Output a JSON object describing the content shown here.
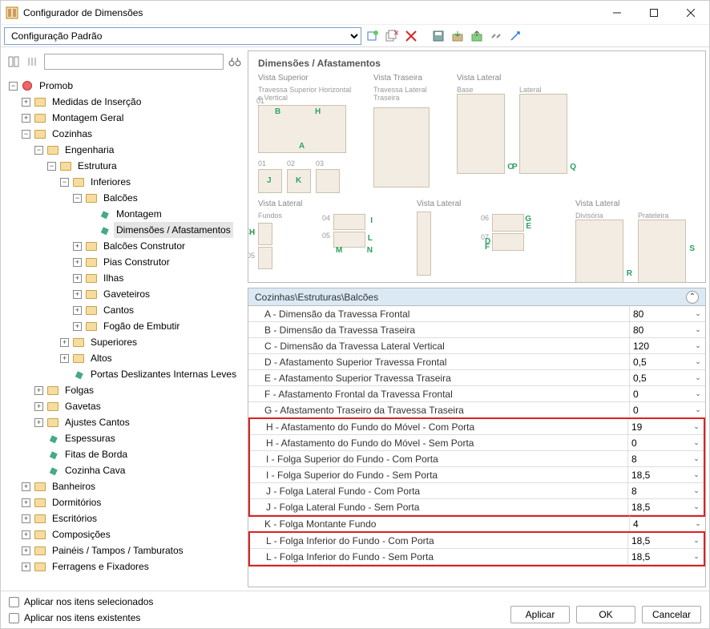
{
  "window": {
    "title": "Configurador de Dimensões"
  },
  "toolbar": {
    "config_selected": "Configuração Padrão"
  },
  "filter": {
    "placeholder": ""
  },
  "tree": {
    "root": "Promob",
    "n1": "Medidas de Inserção",
    "n2": "Montagem Geral",
    "n3": "Cozinhas",
    "n3_1": "Engenharia",
    "n3_1_1": "Estrutura",
    "n3_1_1_1": "Inferiores",
    "n3_1_1_1_1": "Balcões",
    "n3_1_1_1_1_1": "Montagem",
    "n3_1_1_1_1_2": "Dimensões / Afastamentos",
    "n3_1_1_1_2": "Balcões Construtor",
    "n3_1_1_1_3": "Pias Construtor",
    "n3_1_1_1_4": "Ilhas",
    "n3_1_1_1_5": "Gaveteiros",
    "n3_1_1_1_6": "Cantos",
    "n3_1_1_1_7": "Fogão de Embutir",
    "n3_1_1_2": "Superiores",
    "n3_1_1_3": "Altos",
    "n3_1_1_4": "Portas Deslizantes Internas Leves",
    "n3_2": "Folgas",
    "n3_3": "Gavetas",
    "n3_4": "Ajustes Cantos",
    "n3_5": "Espessuras",
    "n3_6": "Fitas de Borda",
    "n3_7": "Cozinha Cava",
    "n4": "Banheiros",
    "n5": "Dormitórios",
    "n6": "Escritórios",
    "n7": "Composições",
    "n8": "Painéis / Tampos / Tamburatos",
    "n9": "Ferragens e Fixadores"
  },
  "diagram": {
    "title": "Dimensões / Afastamentos",
    "v1": "Vista Superior",
    "v1s": "Travessa Superior Horizontal e Vertical",
    "v2": "Vista Traseira",
    "v2s": "Travessa Lateral Traseira",
    "v3": "Vista Lateral",
    "v3s": "Base",
    "v3s2": "Lateral",
    "v4": "Vista Lateral",
    "v4s": "Fundos",
    "v5": "Vista Lateral",
    "v6": "Vista Lateral",
    "v6s": "Divisória",
    "v6s2": "Prateleira",
    "dims": {
      "A": "A",
      "B": "B",
      "H": "H",
      "J": "J",
      "K": "K",
      "I": "I",
      "L": "L",
      "M": "M",
      "N": "N",
      "O": "O",
      "P": "P",
      "Q": "Q",
      "R": "R",
      "S": "S",
      "G": "G",
      "D": "D",
      "F": "F",
      "E": "E"
    },
    "nums": {
      "o1": "01",
      "o2": "02",
      "o3": "03",
      "o4": "04",
      "o5": "05",
      "o6": "06",
      "o7": "07"
    }
  },
  "props": {
    "header": "Cozinhas\\Estruturas\\Balcões",
    "rows": [
      {
        "label": "A - Dimensão da Travessa Frontal",
        "value": "80",
        "hl": false
      },
      {
        "label": "B - Dimensão da Travessa Traseira",
        "value": "80",
        "hl": false
      },
      {
        "label": "C - Dimensão da Travessa Lateral Vertical",
        "value": "120",
        "hl": false
      },
      {
        "label": "D - Afastamento Superior Travessa Frontal",
        "value": "0,5",
        "hl": false
      },
      {
        "label": "E - Afastamento Superior Travessa Traseira",
        "value": "0,5",
        "hl": false
      },
      {
        "label": "F - Afastamento Frontal da Travessa Frontal",
        "value": "0",
        "hl": false
      },
      {
        "label": "G - Afastamento Traseiro da Travessa Traseira",
        "value": "0",
        "hl": false
      },
      {
        "label": "H - Afastamento do Fundo do Móvel - Com Porta",
        "value": "19",
        "hl": true
      },
      {
        "label": "H - Afastamento do Fundo do Móvel - Sem Porta",
        "value": "0",
        "hl": true
      },
      {
        "label": "I - Folga Superior do Fundo - Com Porta",
        "value": "8",
        "hl": true
      },
      {
        "label": "I - Folga Superior do Fundo - Sem Porta",
        "value": "18,5",
        "hl": true
      },
      {
        "label": "J - Folga Lateral Fundo - Com Porta",
        "value": "8",
        "hl": true
      },
      {
        "label": "J - Folga Lateral Fundo - Sem Porta",
        "value": "18,5",
        "hl": true
      },
      {
        "label": "K - Folga Montante Fundo",
        "value": "4",
        "hl": false
      },
      {
        "label": "L - Folga Inferior do Fundo - Com Porta",
        "value": "18,5",
        "hl": true
      },
      {
        "label": "L - Folga Inferior do Fundo - Sem Porta",
        "value": "18,5",
        "hl": true
      }
    ]
  },
  "footer": {
    "chk1": "Aplicar nos itens selecionados",
    "chk2": "Aplicar nos itens existentes",
    "btn_apply": "Aplicar",
    "btn_ok": "OK",
    "btn_cancel": "Cancelar"
  }
}
